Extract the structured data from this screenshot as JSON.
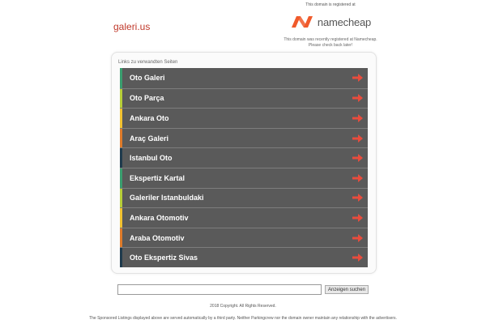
{
  "site": {
    "title": "galeri.us"
  },
  "registrar": {
    "note": "This domain is registered at",
    "brand_name": "namecheap",
    "brand_color": "#f05a2b",
    "desc_line1": "This domain was recently registered at Namecheap.",
    "desc_line2": "Please check back later!"
  },
  "links": {
    "heading": "Links zu verwandten Seiten",
    "items": [
      {
        "label": "Oto Galeri",
        "stripe": "#3a9e6f"
      },
      {
        "label": "Oto Parça",
        "stripe": "#b7cf38"
      },
      {
        "label": "Ankara Oto",
        "stripe": "#f2c230"
      },
      {
        "label": "Araç Galeri",
        "stripe": "#e07b2a"
      },
      {
        "label": "Istanbul Oto",
        "stripe": "#1f3b4d"
      },
      {
        "label": "Ekspertiz Kartal",
        "stripe": "#3a9e6f"
      },
      {
        "label": "Galeriler Istanbuldaki",
        "stripe": "#b7cf38"
      },
      {
        "label": "Ankara Otomotiv",
        "stripe": "#f2c230"
      },
      {
        "label": "Araba Otomotiv",
        "stripe": "#e07b2a"
      },
      {
        "label": "Oto Ekspertiz Sivas",
        "stripe": "#1f3b4d"
      }
    ],
    "arrow_icon": "arrow-right-icon",
    "arrow_color": "#e84c3d"
  },
  "search": {
    "value": "",
    "placeholder": "",
    "button_label": "Anzeigen suchen"
  },
  "footer": {
    "copyright": "2018 Copyright.  All Rights Reserved.",
    "disclaimer": "The Sponsored Listings displayed above are served automatically by a third party. Neither Parkingcrew nor the domain owner maintain any relationship with the advertisers."
  }
}
